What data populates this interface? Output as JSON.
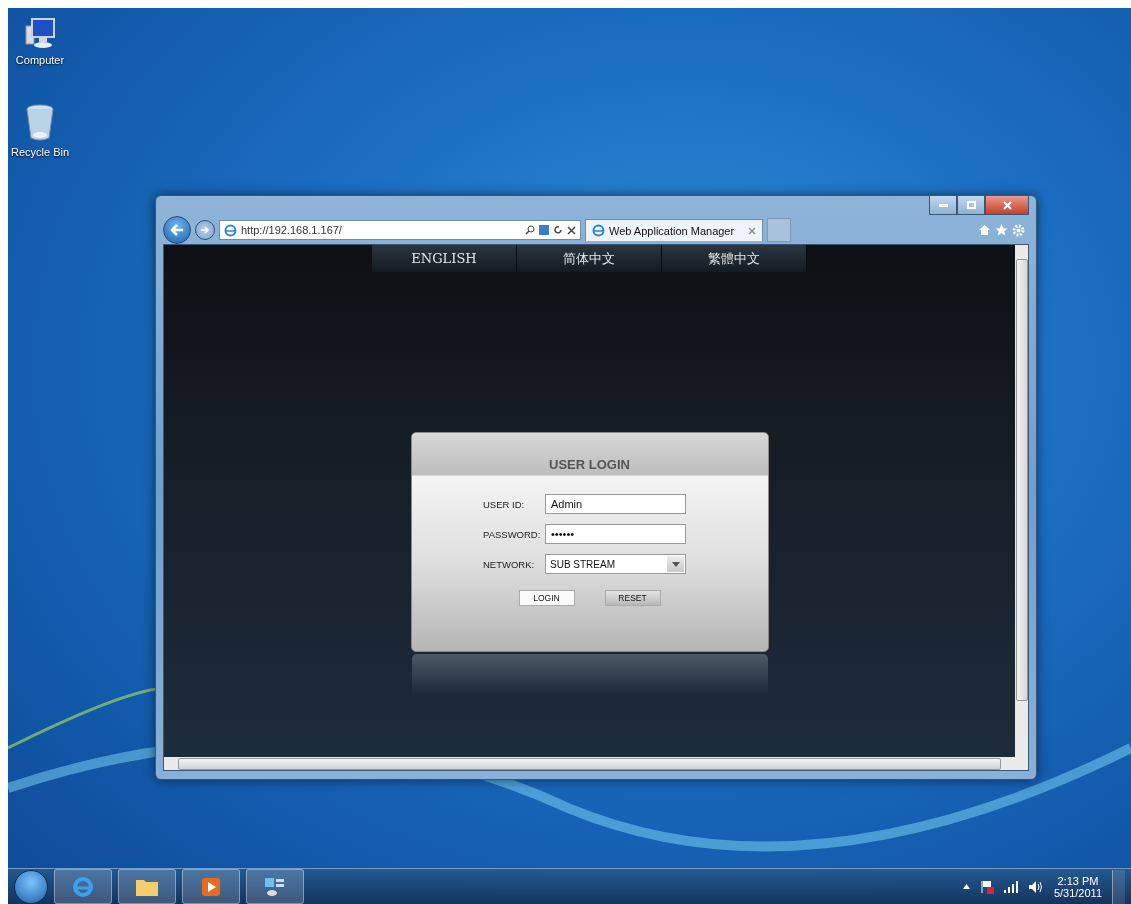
{
  "desktop_icons": [
    {
      "kind": "computer",
      "label": "Computer"
    },
    {
      "kind": "recycle",
      "label": "Recycle Bin"
    }
  ],
  "browser": {
    "address": "http://192.168.1.167/",
    "tab": {
      "title": "Web Application Manager",
      "selected": true
    }
  },
  "page": {
    "languages": [
      {
        "label": "ENGLISH"
      },
      {
        "label": "简体中文"
      },
      {
        "label": "繁體中文"
      }
    ],
    "login": {
      "title": "USER LOGIN",
      "fields": [
        {
          "kind": "text",
          "label": "USER ID:",
          "value": "Admin"
        },
        {
          "kind": "password",
          "label": "PASSWORD:",
          "value": "••••••"
        },
        {
          "kind": "select",
          "label": "NETWORK:",
          "value": "SUB STREAM"
        }
      ],
      "buttons": [
        "LOGIN",
        "RESET"
      ]
    }
  },
  "taskbar": {
    "time": "2:13 PM",
    "date": "5/31/2011"
  }
}
